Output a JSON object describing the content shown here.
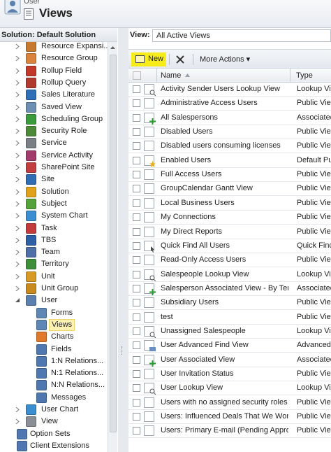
{
  "header": {
    "entity": "User",
    "title": "Views"
  },
  "solution_label": "Solution: Default Solution",
  "tree": [
    {
      "label": "Resource Expansi...",
      "icon": "resource-expansion-icon",
      "color": "#c77a2e",
      "indent": 1,
      "expandable": true
    },
    {
      "label": "Resource Group",
      "icon": "resource-group-icon",
      "color": "#d9833b",
      "indent": 1,
      "expandable": true
    },
    {
      "label": "Rollup Field",
      "icon": "rollup-field-icon",
      "color": "#c0392b",
      "indent": 1,
      "expandable": true
    },
    {
      "label": "Rollup Query",
      "icon": "rollup-query-icon",
      "color": "#b03a2e",
      "indent": 1,
      "expandable": true
    },
    {
      "label": "Sales Literature",
      "icon": "sales-literature-icon",
      "color": "#2e6fb7",
      "indent": 1,
      "expandable": true
    },
    {
      "label": "Saved View",
      "icon": "saved-view-icon",
      "color": "#6d8fb3",
      "indent": 1,
      "expandable": true
    },
    {
      "label": "Scheduling Group",
      "icon": "scheduling-group-icon",
      "color": "#3b9a3e",
      "indent": 1,
      "expandable": true
    },
    {
      "label": "Security Role",
      "icon": "security-role-icon",
      "color": "#4c8a3a",
      "indent": 1,
      "expandable": true
    },
    {
      "label": "Service",
      "icon": "service-icon",
      "color": "#7a7f86",
      "indent": 1,
      "expandable": true
    },
    {
      "label": "Service Activity",
      "icon": "service-activity-icon",
      "color": "#a23a6b",
      "indent": 1,
      "expandable": true
    },
    {
      "label": "SharePoint Site",
      "icon": "sharepoint-site-icon",
      "color": "#c23e3e",
      "indent": 1,
      "expandable": true
    },
    {
      "label": "Site",
      "icon": "site-icon",
      "color": "#2f6db5",
      "indent": 1,
      "expandable": true
    },
    {
      "label": "Solution",
      "icon": "solution-icon",
      "color": "#e0a21a",
      "indent": 1,
      "expandable": true
    },
    {
      "label": "Subject",
      "icon": "subject-icon",
      "color": "#56a23a",
      "indent": 1,
      "expandable": true
    },
    {
      "label": "System Chart",
      "icon": "system-chart-icon",
      "color": "#3a8fd0",
      "indent": 1,
      "expandable": true
    },
    {
      "label": "Task",
      "icon": "task-icon",
      "color": "#c23c3c",
      "indent": 1,
      "expandable": true
    },
    {
      "label": "TBS",
      "icon": "tbs-icon",
      "color": "#2c5fa5",
      "indent": 1,
      "expandable": true
    },
    {
      "label": "Team",
      "icon": "team-icon",
      "color": "#4f6fa8",
      "indent": 1,
      "expandable": true
    },
    {
      "label": "Territory",
      "icon": "territory-icon",
      "color": "#3e8e3a",
      "indent": 1,
      "expandable": true
    },
    {
      "label": "Unit",
      "icon": "unit-icon",
      "color": "#d69a25",
      "indent": 1,
      "expandable": true
    },
    {
      "label": "Unit Group",
      "icon": "unit-group-icon",
      "color": "#c88a1e",
      "indent": 1,
      "expandable": true
    },
    {
      "label": "User",
      "icon": "user-icon",
      "color": "#5b7fae",
      "indent": 1,
      "expandable": true,
      "expanded": true
    },
    {
      "label": "Forms",
      "icon": "forms-icon",
      "color": "#5f87b5",
      "indent": 2,
      "expandable": false
    },
    {
      "label": "Views",
      "icon": "views-icon",
      "color": "#5f87b5",
      "indent": 2,
      "expandable": false,
      "selected": true
    },
    {
      "label": "Charts",
      "icon": "charts-icon",
      "color": "#e07a2a",
      "indent": 2,
      "expandable": false
    },
    {
      "label": "Fields",
      "icon": "fields-icon",
      "color": "#4f78b0",
      "indent": 2,
      "expandable": false
    },
    {
      "label": "1:N Relations...",
      "icon": "one-to-many-icon",
      "color": "#4f78b0",
      "indent": 2,
      "expandable": false
    },
    {
      "label": "N:1 Relations...",
      "icon": "many-to-one-icon",
      "color": "#4f78b0",
      "indent": 2,
      "expandable": false
    },
    {
      "label": "N:N Relations...",
      "icon": "many-to-many-icon",
      "color": "#4f78b0",
      "indent": 2,
      "expandable": false
    },
    {
      "label": "Messages",
      "icon": "messages-icon",
      "color": "#4f78b0",
      "indent": 2,
      "expandable": false
    },
    {
      "label": "User Chart",
      "icon": "user-chart-icon",
      "color": "#3a8fd0",
      "indent": 1,
      "expandable": true
    },
    {
      "label": "View",
      "icon": "view-icon",
      "color": "#8a8f96",
      "indent": 1,
      "expandable": true
    },
    {
      "label": "Option Sets",
      "icon": "option-sets-icon",
      "color": "#4f78b0",
      "indent": 0,
      "expandable": false
    },
    {
      "label": "Client Extensions",
      "icon": "client-extensions-icon",
      "color": "#4f78b0",
      "indent": 0,
      "expandable": false
    }
  ],
  "view_selector": {
    "label": "View:",
    "value": "All Active Views"
  },
  "toolbar": {
    "new_label": "New",
    "more_actions_label": "More Actions"
  },
  "grid": {
    "col_name": "Name",
    "col_type": "Type",
    "rows": [
      {
        "name": "Activity Sender Users Lookup View",
        "type": "Lookup View",
        "badge": "lookup"
      },
      {
        "name": "Administrative Access Users",
        "type": "Public View",
        "badge": ""
      },
      {
        "name": "All Salespersons",
        "type": "Associated View",
        "badge": "associated"
      },
      {
        "name": "Disabled Users",
        "type": "Public View",
        "badge": ""
      },
      {
        "name": "Disabled users consuming licenses",
        "type": "Public View",
        "badge": ""
      },
      {
        "name": "Enabled Users",
        "type": "Default Public View",
        "badge": "default"
      },
      {
        "name": "Full Access Users",
        "type": "Public View",
        "badge": ""
      },
      {
        "name": "GroupCalendar Gantt View",
        "type": "Public View",
        "badge": ""
      },
      {
        "name": "Local Business Users",
        "type": "Public View",
        "badge": ""
      },
      {
        "name": "My Connections",
        "type": "Public View",
        "badge": ""
      },
      {
        "name": "My Direct Reports",
        "type": "Public View",
        "badge": ""
      },
      {
        "name": "Quick Find All Users",
        "type": "Quick Find View",
        "badge": "quickfind"
      },
      {
        "name": "Read-Only Access Users",
        "type": "Public View",
        "badge": ""
      },
      {
        "name": "Salespeople Lookup View",
        "type": "Lookup View",
        "badge": "lookup"
      },
      {
        "name": "Salesperson Associated View - By Territory",
        "type": "Associated View",
        "badge": "associated"
      },
      {
        "name": "Subsidiary Users",
        "type": "Public View",
        "badge": ""
      },
      {
        "name": "test",
        "type": "Public View",
        "badge": ""
      },
      {
        "name": "Unassigned Salespeople",
        "type": "Lookup View",
        "badge": "lookup"
      },
      {
        "name": "User Advanced Find View",
        "type": "Advanced Find View",
        "badge": "advanced"
      },
      {
        "name": "User Associated View",
        "type": "Associated View",
        "badge": "associated"
      },
      {
        "name": "User Invitation Status",
        "type": "Public View",
        "badge": ""
      },
      {
        "name": "User Lookup View",
        "type": "Lookup View",
        "badge": "lookup"
      },
      {
        "name": "Users with no assigned security roles",
        "type": "Public View",
        "badge": ""
      },
      {
        "name": "Users: Influenced Deals That We Won",
        "type": "Public View",
        "badge": ""
      },
      {
        "name": "Users: Primary E-mail (Pending Approval)",
        "type": "Public View",
        "badge": ""
      }
    ]
  },
  "colors": {
    "highlight": "#f5ec1a",
    "selected_bg": "#fdf1b4",
    "accent_green": "#2e9a34"
  }
}
